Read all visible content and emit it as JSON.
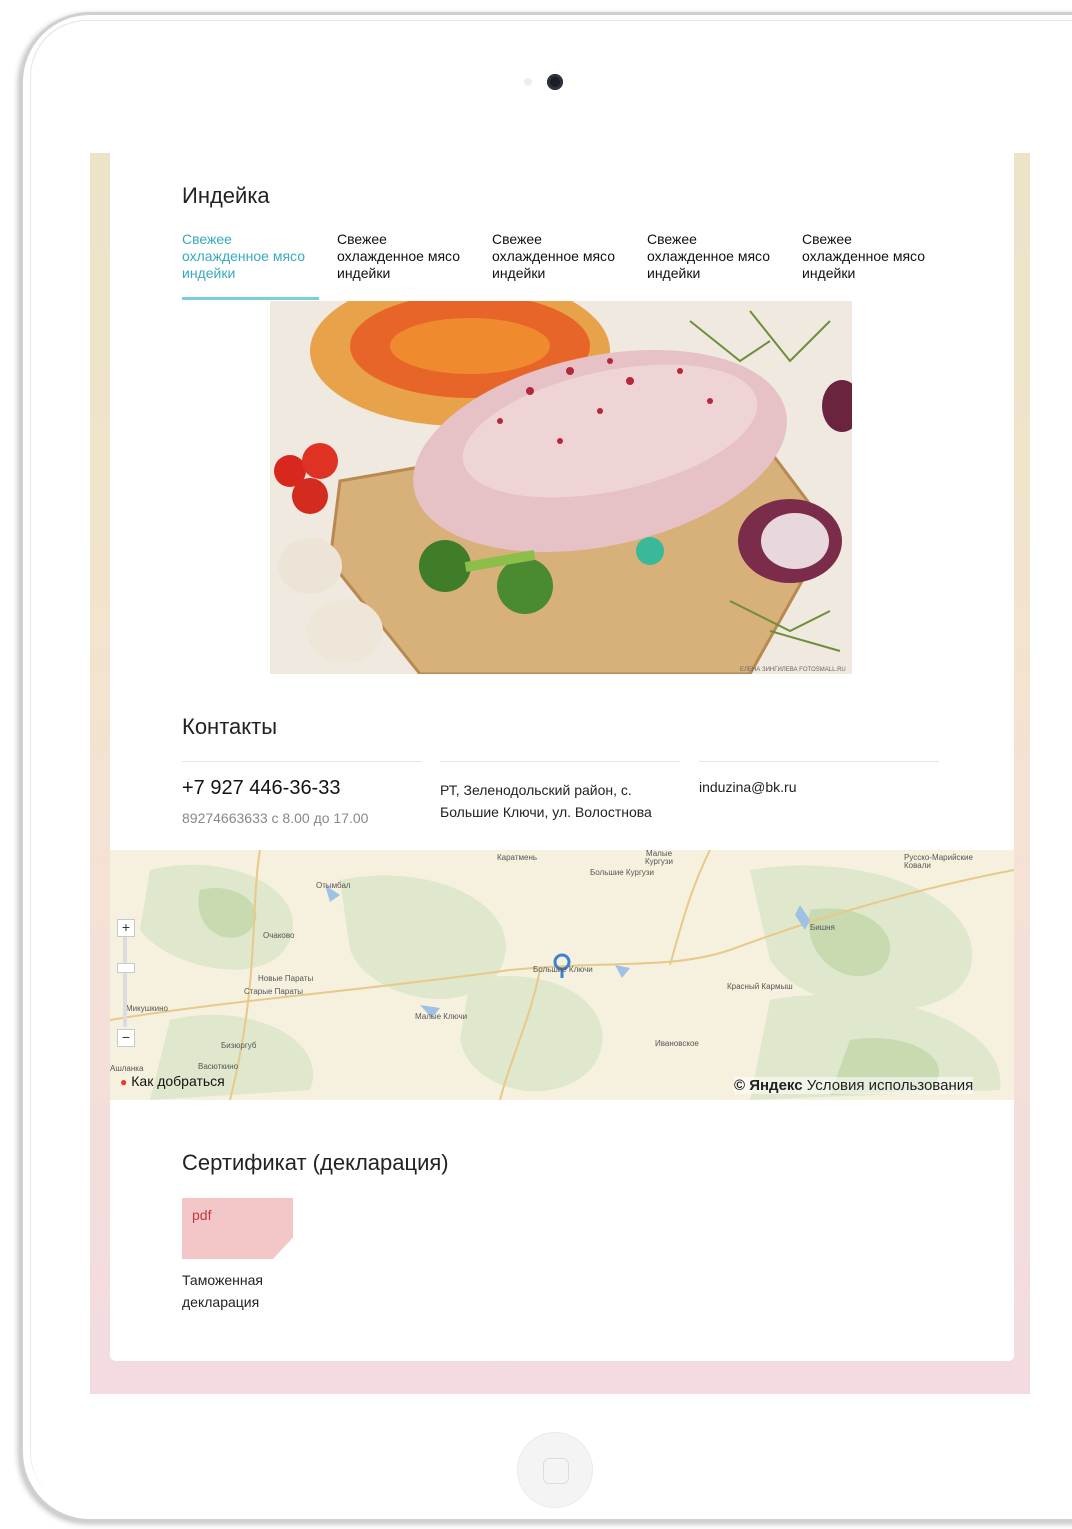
{
  "product": {
    "title": "Индейка",
    "tabs": [
      {
        "label": "Свежее охлажденное мясо индейки",
        "active": true
      },
      {
        "label": "Свежее охлажденное мясо индейки",
        "active": false
      },
      {
        "label": "Свежее охлажденное мясо индейки",
        "active": false
      },
      {
        "label": "Свежее охлажденное мясо индейки",
        "active": false
      },
      {
        "label": "Свежее охлажденное мясо индейки",
        "active": false
      }
    ],
    "photo_watermark": "ЕЛЕНА ЗИНГИЛЕВА  FOTOSMALL.RU"
  },
  "contacts": {
    "title": "Контакты",
    "phone": "+7 927 446-36-33",
    "phone_note": "89274663633 с 8.00 до 17.00",
    "address": "РТ, Зеленодольский район, с. Большие Ключи, ул. Волостнова",
    "email": "induzina@bk.ru"
  },
  "map": {
    "zoom_in": "+",
    "zoom_out": "−",
    "route_link": "Как добраться",
    "copyright": "© Яндекс",
    "terms": "Условия использования",
    "places": {
      "karatmen": "Каратмень",
      "malye_kurguzi": "Малые Кургузи",
      "bolshie_kurguzi": "Большие Кургузи",
      "russko": "Русско-Марийские Ковали",
      "otymbal": "Отымбал",
      "ochakovo": "Очаково",
      "bishnya": "Бишня",
      "novye_paraty": "Новые Параты",
      "starye_paraty": "Старые Параты",
      "bolshie_klyuchi": "Большие Ключи",
      "krasny_karmysh": "Красный Кармыш",
      "mikushkino": "Микушкино",
      "malye_klyuchi": "Малые Ключи",
      "ivanovskoe": "Ивановское",
      "bizyurgub": "Бизюргуб",
      "ashlanka": "Ашланка",
      "vasyutkino": "Васюткино"
    },
    "accent_color": "#3b82d6"
  },
  "certificate": {
    "title": "Сертификат (декларация)",
    "file_type": "pdf",
    "file_name": "Таможенная декларация"
  },
  "colors": {
    "accent": "#37a9bd",
    "pdf_bg": "#f3c7c8",
    "pdf_text": "#c0393f"
  }
}
